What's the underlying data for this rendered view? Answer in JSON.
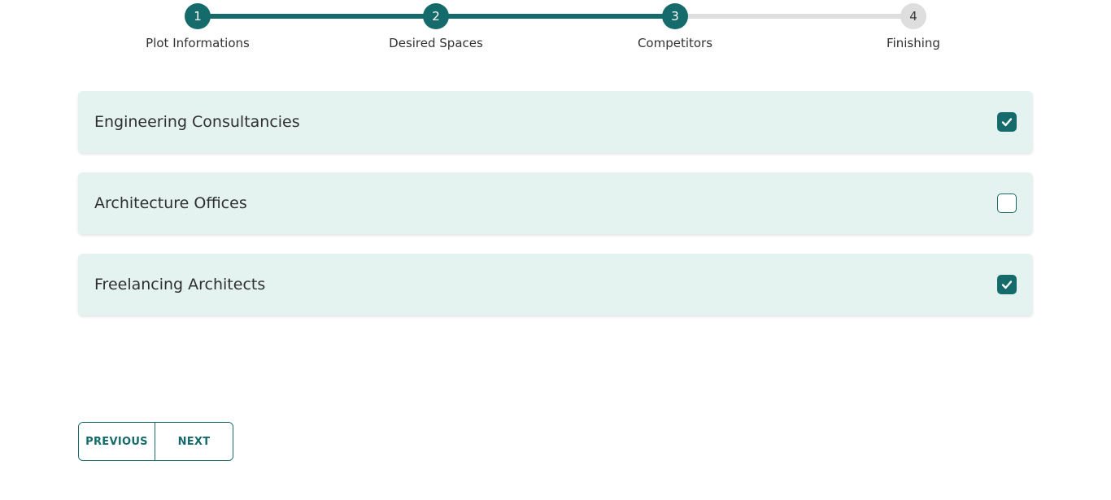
{
  "stepper": {
    "steps": [
      {
        "number": "1",
        "label": "Plot Informations",
        "state": "done"
      },
      {
        "number": "2",
        "label": "Desired Spaces",
        "state": "done"
      },
      {
        "number": "3",
        "label": "Competitors",
        "state": "current"
      },
      {
        "number": "4",
        "label": "Finishing",
        "state": "todo"
      }
    ],
    "completed_color": "#156b6b",
    "pending_color": "#dedede"
  },
  "options": [
    {
      "label": "Engineering Consultancies",
      "checked": true
    },
    {
      "label": "Architecture Offices",
      "checked": false
    },
    {
      "label": "Freelancing Architects",
      "checked": true
    }
  ],
  "colors": {
    "accent": "#156b6b",
    "card_background": "#e4f3f0"
  },
  "navigation": {
    "previous_label": "PREVIOUS",
    "next_label": "NEXT"
  }
}
